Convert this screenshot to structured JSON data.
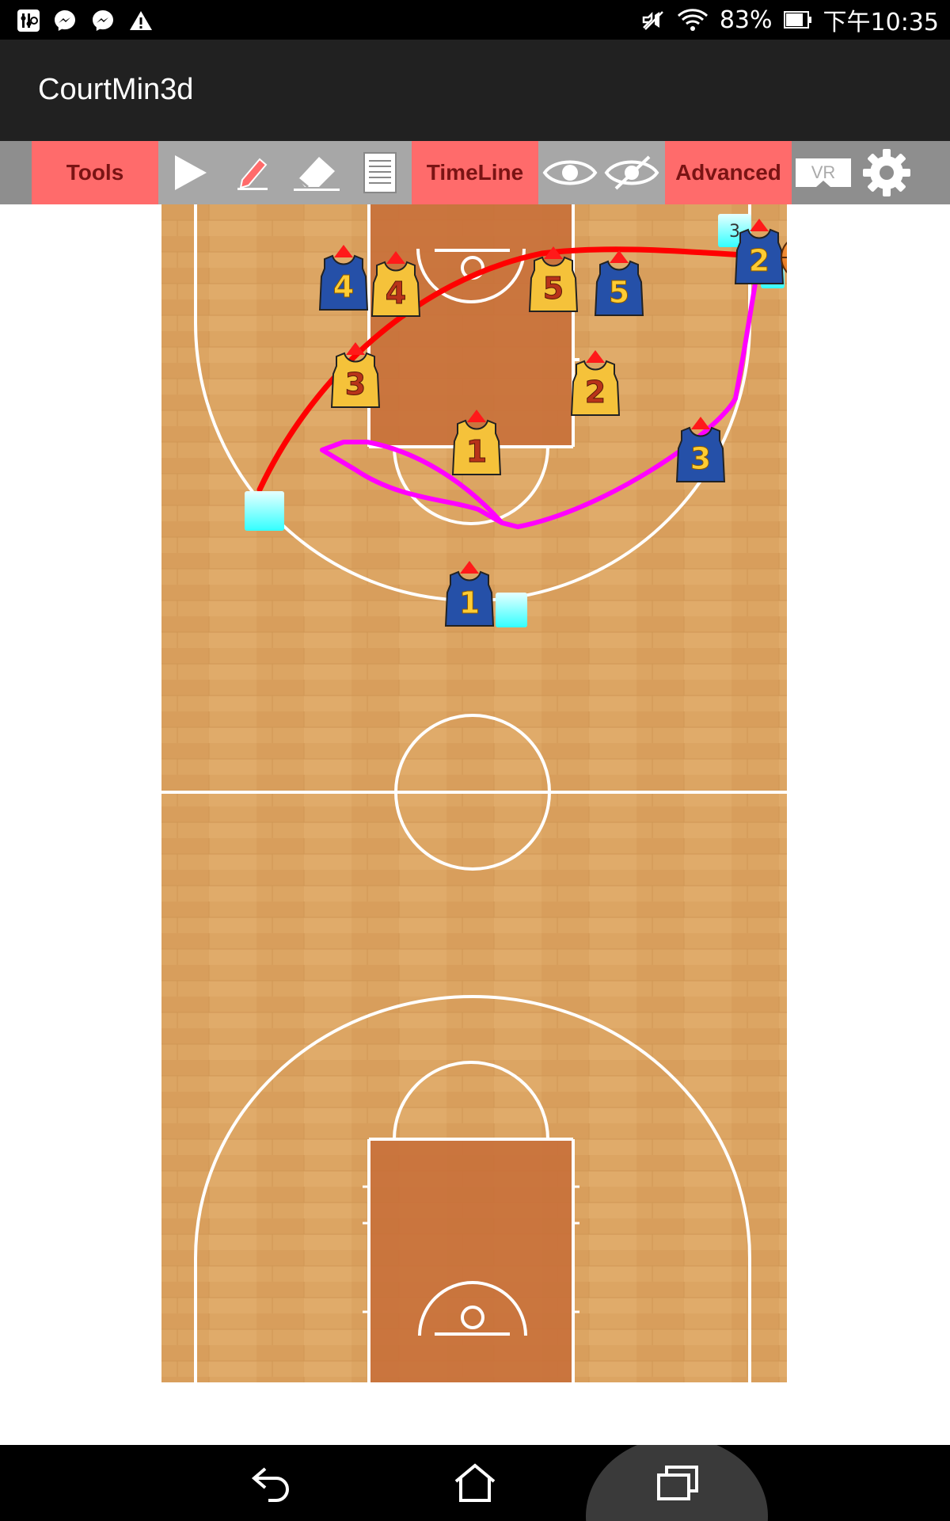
{
  "status_bar": {
    "icons_left": [
      "equalizer-icon",
      "messenger-icon",
      "messenger-icon",
      "warning-icon"
    ],
    "icons_right": [
      "mute-icon",
      "wifi-icon",
      "battery-icon"
    ],
    "battery": "83%",
    "time": "下午10:35"
  },
  "app": {
    "title": "CourtMin3d"
  },
  "toolbar": {
    "tools_label": "Tools",
    "timeline_label": "TimeLine",
    "advanced_label": "Advanced",
    "vr_label": "VR",
    "icons": [
      "play-icon",
      "pen-icon",
      "eraser-icon",
      "document-icon",
      "eye-icon",
      "eye-off-icon",
      "vr-icon",
      "gear-icon"
    ],
    "red": "#ff6b6b"
  },
  "court": {
    "players": [
      {
        "team": "blue",
        "number": "4"
      },
      {
        "team": "yellow",
        "number": "4"
      },
      {
        "team": "yellow",
        "number": "5"
      },
      {
        "team": "blue",
        "number": "5"
      },
      {
        "team": "yellow",
        "number": "3"
      },
      {
        "team": "yellow",
        "number": "2"
      },
      {
        "team": "yellow",
        "number": "1"
      },
      {
        "team": "blue",
        "number": "3"
      },
      {
        "team": "blue",
        "number": "1"
      },
      {
        "team": "blue",
        "number": "2"
      }
    ],
    "markers": [
      {
        "label": "3"
      }
    ],
    "ball": "basketball-icon",
    "path_colors": {
      "pass": "#ff0000",
      "movement": "#ff00ff"
    },
    "colors": {
      "wood": "#dca563",
      "paint": "#c8703a",
      "blue_jersey": "#2550a8",
      "yellow_jersey": "#f5c23a"
    }
  },
  "nav_bar": {
    "icons": [
      "back-icon",
      "home-icon",
      "recents-icon"
    ]
  }
}
